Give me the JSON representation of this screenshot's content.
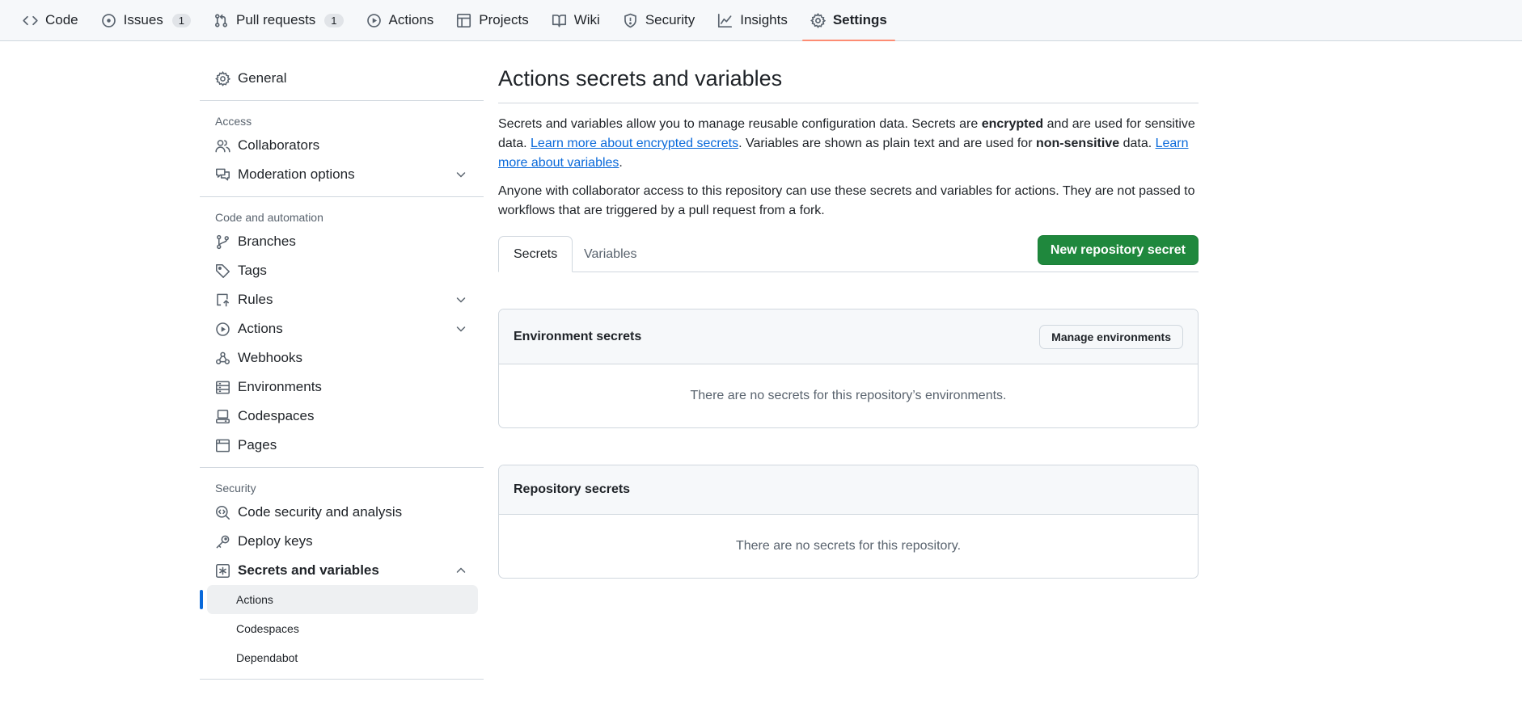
{
  "repo_nav": {
    "tabs": [
      {
        "label": "Code",
        "icon": "code-icon"
      },
      {
        "label": "Issues",
        "icon": "issue-icon",
        "count": "1"
      },
      {
        "label": "Pull requests",
        "icon": "pull-request-icon",
        "count": "1"
      },
      {
        "label": "Actions",
        "icon": "play-icon"
      },
      {
        "label": "Projects",
        "icon": "table-icon"
      },
      {
        "label": "Wiki",
        "icon": "book-icon"
      },
      {
        "label": "Security",
        "icon": "shield-icon"
      },
      {
        "label": "Insights",
        "icon": "graph-icon"
      },
      {
        "label": "Settings",
        "icon": "gear-icon",
        "selected": true
      }
    ]
  },
  "sidebar": {
    "general": "General",
    "access_heading": "Access",
    "collaborators": "Collaborators",
    "moderation": "Moderation options",
    "code_heading": "Code and automation",
    "branches": "Branches",
    "tags": "Tags",
    "rules": "Rules",
    "actions": "Actions",
    "webhooks": "Webhooks",
    "environments": "Environments",
    "codespaces": "Codespaces",
    "pages": "Pages",
    "security_heading": "Security",
    "code_security": "Code security and analysis",
    "deploy_keys": "Deploy keys",
    "secrets_vars": "Secrets and variables",
    "sub_actions": "Actions",
    "sub_codespaces": "Codespaces",
    "sub_dependabot": "Dependabot"
  },
  "main": {
    "title": "Actions secrets and variables",
    "desc1_a": "Secrets and variables allow you to manage reusable configuration data. Secrets are ",
    "desc1_b": "encrypted",
    "desc1_c": " and are used for sensitive data. ",
    "desc1_link1": "Learn more about encrypted secrets",
    "desc1_d": ". Variables are shown as plain text and are used for ",
    "desc1_e": "non-sensitive",
    "desc1_f": " data. ",
    "desc1_link2": "Learn more about variables",
    "desc1_g": ".",
    "desc2": "Anyone with collaborator access to this repository can use these secrets and variables for actions. They are not passed to workflows that are triggered by a pull request from a fork.",
    "tab_secrets": "Secrets",
    "tab_variables": "Variables",
    "new_secret_btn": "New repository secret",
    "env_heading": "Environment secrets",
    "manage_env_btn": "Manage environments",
    "env_empty": "There are no secrets for this repository’s environments.",
    "repo_heading": "Repository secrets",
    "repo_empty": "There are no secrets for this repository."
  },
  "colors": {
    "accent": "#0969da",
    "selected_underline": "#fd8c73",
    "primary_button": "#1f883d"
  }
}
